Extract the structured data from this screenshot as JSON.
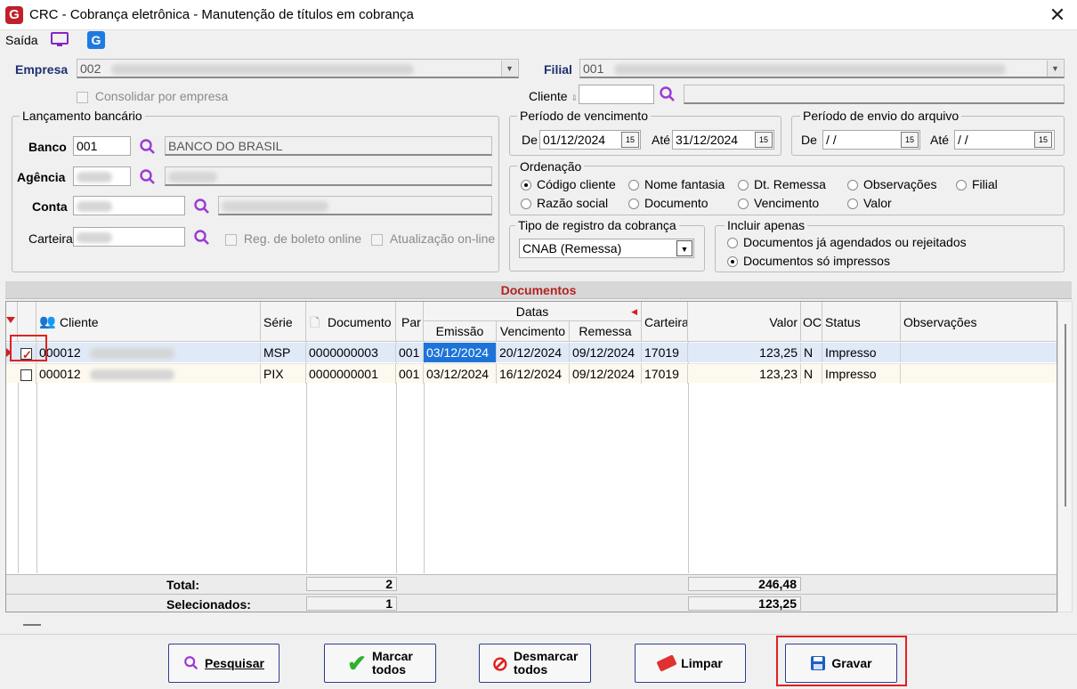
{
  "window": {
    "title": "CRC - Cobrança eletrônica - Manutenção de títulos em cobrança",
    "logo": "G"
  },
  "menu": {
    "saida": "Saída",
    "g_icon": "G"
  },
  "empresa": {
    "label": "Empresa",
    "code": "002",
    "consolidar": "Consolidar por empresa"
  },
  "filial": {
    "label": "Filial",
    "code": "001"
  },
  "cliente": {
    "label": "Cliente"
  },
  "lancamento": {
    "title": "Lançamento bancário",
    "banco_label": "Banco",
    "banco_code": "001",
    "banco_name": "BANCO DO BRASIL",
    "agencia_label": "Agência",
    "conta_label": "Conta",
    "carteira_label": "Carteira",
    "reg_boleto": "Reg. de boleto online",
    "atualizacao": "Atualização on-line"
  },
  "vencimento": {
    "title": "Período de vencimento",
    "de_label": "De",
    "de": "01/12/2024",
    "ate_label": "Até",
    "ate": "31/12/2024"
  },
  "envio": {
    "title": "Período de envio do arquivo",
    "de_label": "De",
    "de": " / /",
    "ate_label": "Até",
    "ate": " / /"
  },
  "ordenacao": {
    "title": "Ordenação",
    "options": [
      "Código cliente",
      "Nome fantasia",
      "Dt. Remessa",
      "Observações",
      "Filial",
      "Razão social",
      "Documento",
      "Vencimento",
      "Valor"
    ],
    "selected": "Código cliente"
  },
  "tipo_registro": {
    "title": "Tipo de registro da cobrança",
    "value": "CNAB (Remessa)"
  },
  "incluir": {
    "title": "Incluir apenas",
    "options": [
      "Documentos já agendados ou rejeitados",
      "Documentos só impressos"
    ],
    "selected": "Documentos só impressos"
  },
  "grid": {
    "section_title": "Documentos",
    "headers": {
      "cliente": "Cliente",
      "serie": "Série",
      "documento": "Documento",
      "par": "Par",
      "datas": "Datas",
      "emissao": "Emissão",
      "vencimento": "Vencimento",
      "remessa": "Remessa",
      "carteira": "Carteira",
      "valor": "Valor",
      "oc": "OC",
      "status": "Status",
      "observacoes": "Observações"
    },
    "rows": [
      {
        "checked": true,
        "cliente": "000012",
        "serie": "MSP",
        "documento": "0000000003",
        "par": "001",
        "emissao": "03/12/2024",
        "vencimento": "20/12/2024",
        "remessa": "09/12/2024",
        "carteira": "17019",
        "valor": "123,25",
        "oc": "N",
        "status": "Impresso",
        "observacoes": ""
      },
      {
        "checked": false,
        "cliente": "000012",
        "serie": "PIX",
        "documento": "0000000001",
        "par": "001",
        "emissao": "03/12/2024",
        "vencimento": "16/12/2024",
        "remessa": "09/12/2024",
        "carteira": "17019",
        "valor": "123,23",
        "oc": "N",
        "status": "Impresso",
        "observacoes": ""
      }
    ],
    "total_label": "Total:",
    "total_count": "2",
    "total_valor": "246,48",
    "selecionados_label": "Selecionados:",
    "selecionados_count": "1",
    "selecionados_valor": "123,25"
  },
  "buttons": {
    "pesquisar": "Pesquisar",
    "marcar_1": "Marcar",
    "marcar_2": "todos",
    "desmarcar_1": "Desmarcar",
    "desmarcar_2": "todos",
    "limpar": "Limpar",
    "gravar": "Gravar"
  },
  "colors": {
    "accent_red": "#e02020",
    "label_blue": "#1f2f6f",
    "selection_blue": "#1e73d8",
    "title_red": "#b22222"
  }
}
